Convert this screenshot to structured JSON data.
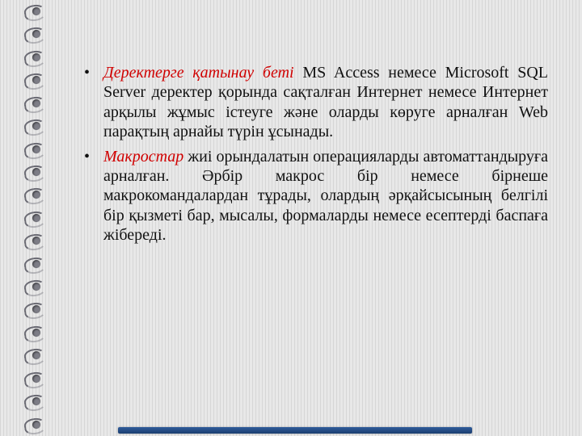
{
  "bullets": [
    {
      "term": "Деректерге қатынау беті",
      "text": " MS Access немесе Microsoft SQL Server деректер қорында сақталған Интернет немесе Интернет арқылы жұмыс істеуге және оларды көруге арналған Web парақтың арнайы түрін ұсынады."
    },
    {
      "term": "Макростар",
      "text": " жиі орындалатын операцияларды автоматтандыруға арналған. Әрбір макрос бір немесе бірнеше макрокомандалардан тұрады, олардың әрқайсысының белгілі бір қызметі бар, мысалы, формаларды немесе есептерді баспаға жібереді."
    }
  ]
}
